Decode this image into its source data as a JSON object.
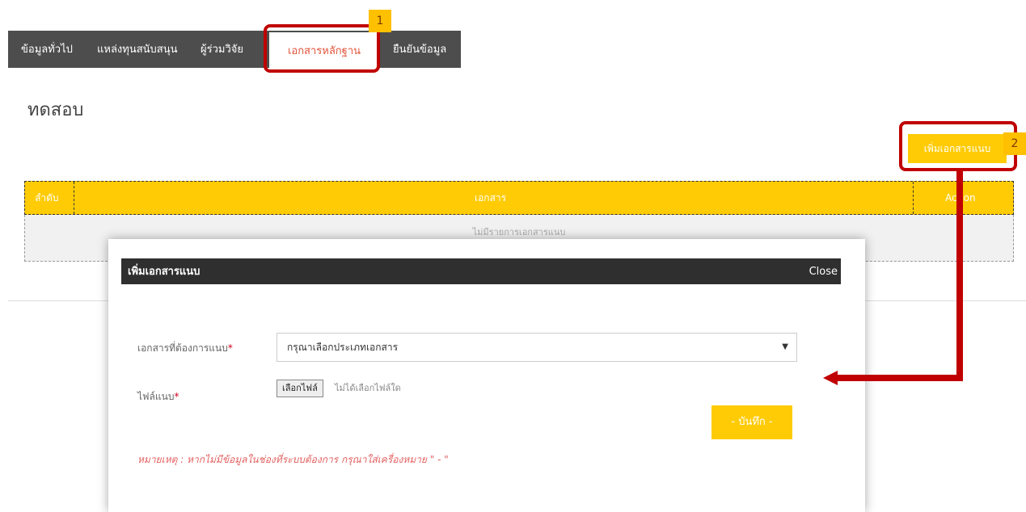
{
  "tabs": [
    {
      "label": "ข้อมูลทั่วไป"
    },
    {
      "label": "แหล่งทุนสนับสนุน"
    },
    {
      "label": "ผู้ร่วมวิจัย"
    },
    {
      "label": "เอกสารหลักฐาน"
    },
    {
      "label": "ยืนยันข้อมูล"
    }
  ],
  "page": {
    "title": "ทดสอบ",
    "add_button": "เพิ่มเอกสารแนบ"
  },
  "table": {
    "headers": [
      "ลำดับ",
      "เอกสาร",
      "Action"
    ],
    "empty_message": "ไม่มีรายการเอกสารแนบ"
  },
  "modal": {
    "title": "เพิ่มเอกสารแนบ",
    "close_label": "Close",
    "doc_label": "เอกสารที่ต้องการแนบ",
    "required_mark": "*",
    "doc_select_value": "กรุณาเลือกประเภทเอกสาร",
    "select_arrow": "▼",
    "file_label": "ไฟล์แนบ",
    "file_button": "เลือกไฟล์",
    "file_status": "ไม่ได้เลือกไฟล์ใด",
    "save_button": "- บันทึก -",
    "note": "หมายเหตุ : หากไม่มีข้อมูลในช่องที่ระบบต้องการ กรุณาใส่เครื่องหมาย \" - \""
  },
  "annotations": {
    "badge_1": "1",
    "badge_2": "2",
    "color": "#c00000"
  },
  "colors": {
    "accent": "#ffcb05",
    "tabbar": "#4d4d4d",
    "active_tab_text": "#e0553a",
    "note": "#e2605f"
  }
}
